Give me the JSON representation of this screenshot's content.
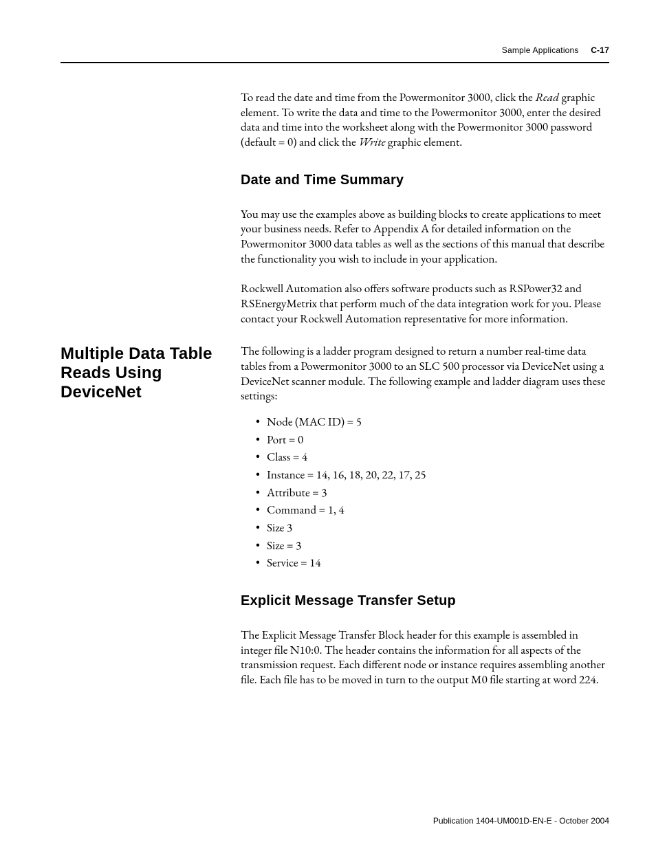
{
  "header": {
    "running_title": "Sample Applications",
    "page_number": "C-17"
  },
  "intro_paragraph": {
    "prefix": "To read the date and time from the Powermonitor 3000, click the ",
    "read_word": "Read",
    "mid": " graphic element. To write the data and time to the Powermonitor 3000, enter the desired data and time into the worksheet along with the Powermonitor 3000 password (default = 0) and click the ",
    "write_word": "Write",
    "suffix": " graphic element."
  },
  "sections": {
    "date_time_summary": {
      "heading": "Date and Time Summary",
      "p1": "You may use the examples above as building blocks to create applications to meet your business needs. Refer to Appendix A for detailed information on the Powermonitor 3000 data tables as well as the sections of this manual that describe the functionality you wish to include in your application.",
      "p2": "Rockwell Automation also offers software products such as RSPower32 and RSEnergyMetrix that perform much of the data integration work for you. Please contact your Rockwell Automation representative for more information."
    },
    "multiple_reads": {
      "side_heading": "Multiple Data Table Reads Using DeviceNet",
      "p1": "The following is a ladder program designed to return a number real-time data tables from a Powermonitor 3000 to an SLC 500 processor via DeviceNet using a DeviceNet scanner module. The following example and ladder diagram uses these settings:",
      "bullets": [
        "Node (MAC ID) = 5",
        "Port = 0",
        "Class = 4",
        "Instance = 14, 16, 18, 20, 22, 17, 25",
        "Attribute = 3",
        "Command = 1, 4",
        "Size 3",
        "Size = 3",
        "Service = 14"
      ]
    },
    "explicit_setup": {
      "heading": "Explicit Message Transfer Setup",
      "p1": "The Explicit Message Transfer Block header for this example is assembled in integer file N10:0. The header contains the information for all aspects of the transmission request. Each different node or instance requires assembling another file. Each file has to be moved in turn to the output M0 file starting at word 224."
    }
  },
  "footer": {
    "text": "Publication 1404-UM001D-EN-E - October 2004"
  }
}
